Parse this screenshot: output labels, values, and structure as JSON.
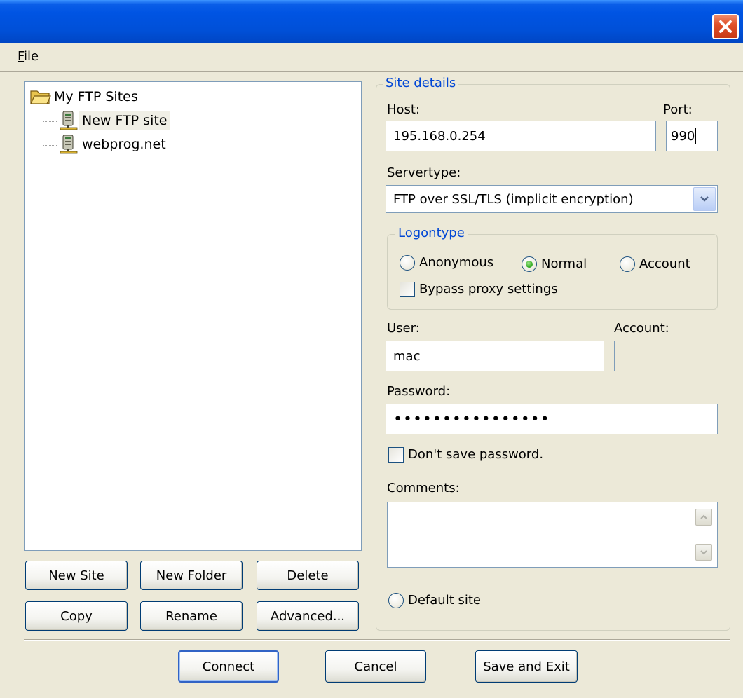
{
  "menu": {
    "file": "File"
  },
  "tree": {
    "root": "My FTP Sites",
    "items": [
      {
        "label": "New FTP site",
        "selected": true
      },
      {
        "label": "webprog.net",
        "selected": false
      }
    ]
  },
  "left_buttons": {
    "new_site": "New Site",
    "new_folder": "New Folder",
    "delete": "Delete",
    "copy": "Copy",
    "rename": "Rename",
    "advanced": "Advanced..."
  },
  "site_details": {
    "legend": "Site details",
    "host_label": "Host:",
    "host_value": "195.168.0.254",
    "port_label": "Port:",
    "port_value": "990",
    "servertype_label": "Servertype:",
    "servertype_value": "FTP over SSL/TLS (implicit encryption)",
    "logontype": {
      "legend": "Logontype",
      "anonymous": "Anonymous",
      "normal": "Normal",
      "account": "Account",
      "selected": "Normal",
      "bypass_proxy": "Bypass proxy settings",
      "bypass_proxy_checked": false
    },
    "user_label": "User:",
    "user_value": "mac",
    "account_label": "Account:",
    "account_value": "",
    "password_label": "Password:",
    "password_value": "••••••••••••••••",
    "dont_save_password": "Don't save password.",
    "dont_save_password_checked": false,
    "comments_label": "Comments:",
    "comments_value": "",
    "default_site": "Default site",
    "default_site_checked": false
  },
  "bottom_buttons": {
    "connect": "Connect",
    "cancel": "Cancel",
    "save_and_exit": "Save and Exit"
  },
  "colors": {
    "titlebar": "#0054e3",
    "window_bg": "#ece9d8",
    "group_legend": "#0046d5",
    "close_button": "#e0502a"
  }
}
